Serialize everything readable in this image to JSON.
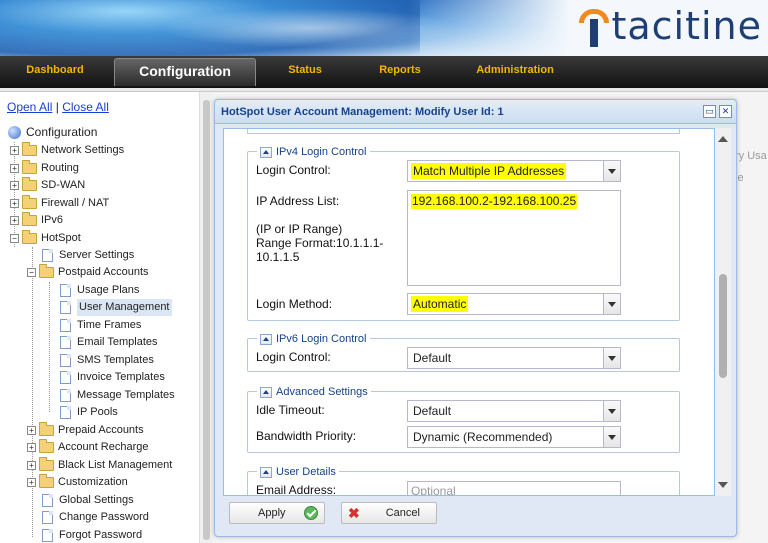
{
  "brand": {
    "logo_text": "tacitine",
    "accent": "#f08a1c",
    "navy": "#1e3f73"
  },
  "nav": {
    "items": [
      {
        "label": "Dashboard"
      },
      {
        "label": "Configuration"
      },
      {
        "label": "Status"
      },
      {
        "label": "Reports"
      },
      {
        "label": "Administration"
      }
    ],
    "active": "Configuration",
    "text_color": "#f2b700"
  },
  "sidebar": {
    "open_all": "Open All",
    "separator": "|",
    "close_all": "Close All",
    "root": "Configuration",
    "items": [
      {
        "label": "Network Settings",
        "type": "folder",
        "state": "collapsed"
      },
      {
        "label": "Routing",
        "type": "folder",
        "state": "collapsed"
      },
      {
        "label": "SD-WAN",
        "type": "folder",
        "state": "collapsed"
      },
      {
        "label": "Firewall / NAT",
        "type": "folder",
        "state": "collapsed"
      },
      {
        "label": "IPv6",
        "type": "folder",
        "state": "collapsed"
      },
      {
        "label": "HotSpot",
        "type": "folder",
        "state": "expanded"
      },
      {
        "label": "Server Settings",
        "type": "page"
      },
      {
        "label": "Postpaid Accounts",
        "type": "folder",
        "state": "expanded"
      },
      {
        "label": "Usage Plans",
        "type": "page"
      },
      {
        "label": "User Management",
        "type": "page",
        "selected": true
      },
      {
        "label": "Time Frames",
        "type": "page"
      },
      {
        "label": "Email Templates",
        "type": "page"
      },
      {
        "label": "SMS Templates",
        "type": "page"
      },
      {
        "label": "Invoice Templates",
        "type": "page"
      },
      {
        "label": "Message Templates",
        "type": "page"
      },
      {
        "label": "IP Pools",
        "type": "page"
      },
      {
        "label": "Prepaid Accounts",
        "type": "folder",
        "state": "collapsed"
      },
      {
        "label": "Account Recharge",
        "type": "folder",
        "state": "collapsed"
      },
      {
        "label": "Black List Management",
        "type": "folder",
        "state": "collapsed"
      },
      {
        "label": "Customization",
        "type": "folder",
        "state": "collapsed"
      },
      {
        "label": "Global Settings",
        "type": "page"
      },
      {
        "label": "Change Password",
        "type": "page"
      },
      {
        "label": "Forgot Password",
        "type": "page"
      }
    ]
  },
  "background": {
    "text1": "ry Usa",
    "text2": "le"
  },
  "dialog": {
    "title": "HotSpot User Account Management: Modify User Id: 1",
    "ipv4": {
      "legend": "IPv4 Login Control",
      "login_control_label": "Login Control:",
      "login_control_value": "Match Multiple IP Addresses",
      "ip_list_label": "IP Address List:",
      "ip_list_hint_1": "(IP or IP Range)",
      "ip_list_hint_2": "Range Format:10.1.1.1-",
      "ip_list_hint_3": "10.1.1.5",
      "ip_list_value": "192.168.100.2-192.168.100.25",
      "login_method_label": "Login Method:",
      "login_method_value": "Automatic"
    },
    "ipv6": {
      "legend": "IPv6 Login Control",
      "login_control_label": "Login Control:",
      "login_control_value": "Default"
    },
    "advanced": {
      "legend": "Advanced Settings",
      "idle_timeout_label": "Idle Timeout:",
      "idle_timeout_value": "Default",
      "bandwidth_label": "Bandwidth Priority:",
      "bandwidth_value": "Dynamic (Recommended)"
    },
    "user_details": {
      "legend": "User Details",
      "email_label": "Email Address:",
      "email_placeholder": "Optional"
    },
    "apply_label": "Apply",
    "cancel_label": "Cancel",
    "highlight_color": "#ffff00"
  }
}
